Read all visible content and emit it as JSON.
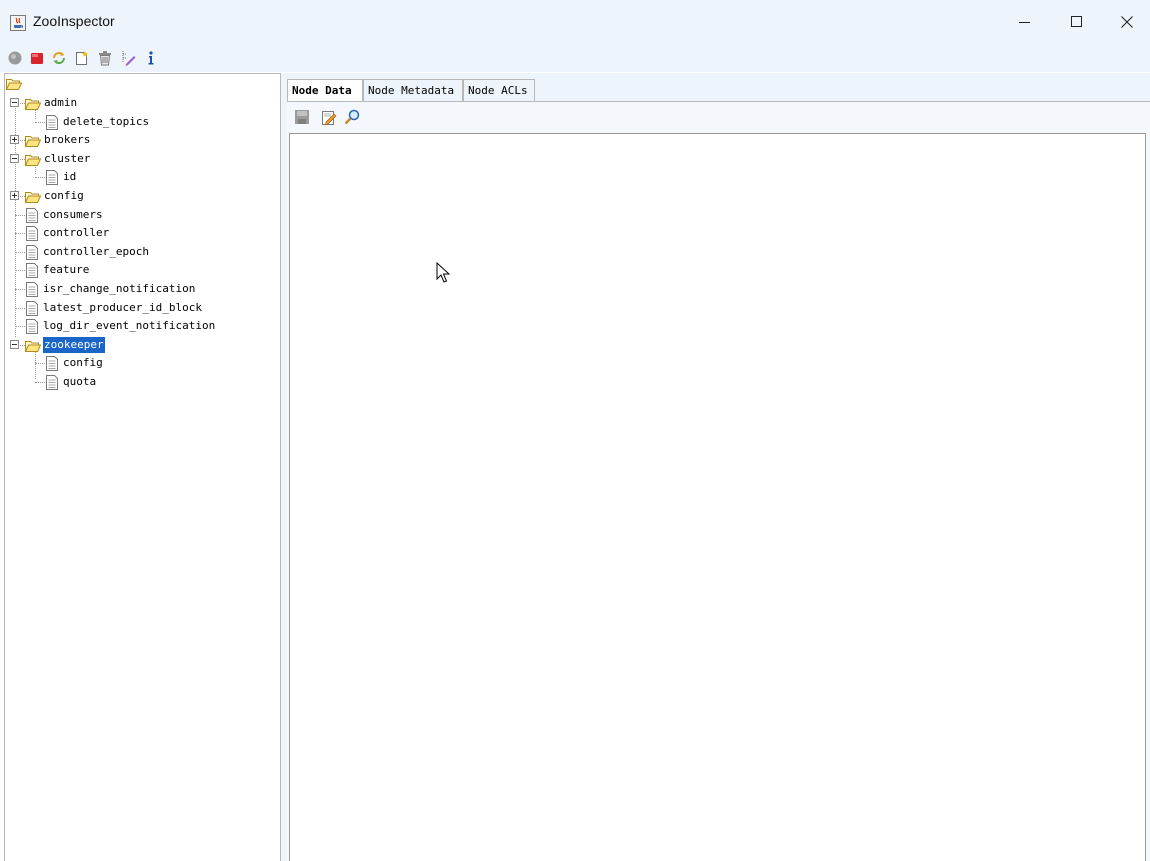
{
  "window": {
    "title": "ZooInspector",
    "icon": "java-app-icon",
    "controls": [
      "minimize-icon",
      "maximize-icon",
      "close-icon"
    ]
  },
  "toolbar": {
    "icons": [
      "connect-icon",
      "disconnect-icon",
      "refresh-icon",
      "add-node-icon",
      "delete-node-icon",
      "edit-node-viewers-icon",
      "about-icon"
    ]
  },
  "tree": {
    "root_icon": "folder-open-icon",
    "nodes": [
      {
        "label": "admin",
        "type": "folder",
        "level": 1,
        "expanded": true
      },
      {
        "label": "delete_topics",
        "type": "file",
        "level": 2
      },
      {
        "label": "brokers",
        "type": "folder",
        "level": 1,
        "expanded": false
      },
      {
        "label": "cluster",
        "type": "folder",
        "level": 1,
        "expanded": true
      },
      {
        "label": "id",
        "type": "file",
        "level": 2
      },
      {
        "label": "config",
        "type": "folder",
        "level": 1,
        "expanded": false
      },
      {
        "label": "consumers",
        "type": "file",
        "level": 1
      },
      {
        "label": "controller",
        "type": "file",
        "level": 1
      },
      {
        "label": "controller_epoch",
        "type": "file",
        "level": 1
      },
      {
        "label": "feature",
        "type": "file",
        "level": 1
      },
      {
        "label": "isr_change_notification",
        "type": "file",
        "level": 1
      },
      {
        "label": "latest_producer_id_block",
        "type": "file",
        "level": 1
      },
      {
        "label": "log_dir_event_notification",
        "type": "file",
        "level": 1
      },
      {
        "label": "zookeeper",
        "type": "folder",
        "level": 1,
        "expanded": true,
        "selected": true
      },
      {
        "label": "config",
        "type": "file",
        "level": 2
      },
      {
        "label": "quota",
        "type": "file",
        "level": 2
      }
    ]
  },
  "tabs": [
    {
      "label": "Node Data",
      "active": true
    },
    {
      "label": "Node Metadata",
      "active": false
    },
    {
      "label": "Node ACLs",
      "active": false
    }
  ],
  "node_data": {
    "toolbar_icons": [
      "save-icon",
      "edit-icon",
      "search-icon"
    ],
    "content": ""
  },
  "colors": {
    "selection": "#1a66c8",
    "panel_background": "#eef4fb"
  }
}
